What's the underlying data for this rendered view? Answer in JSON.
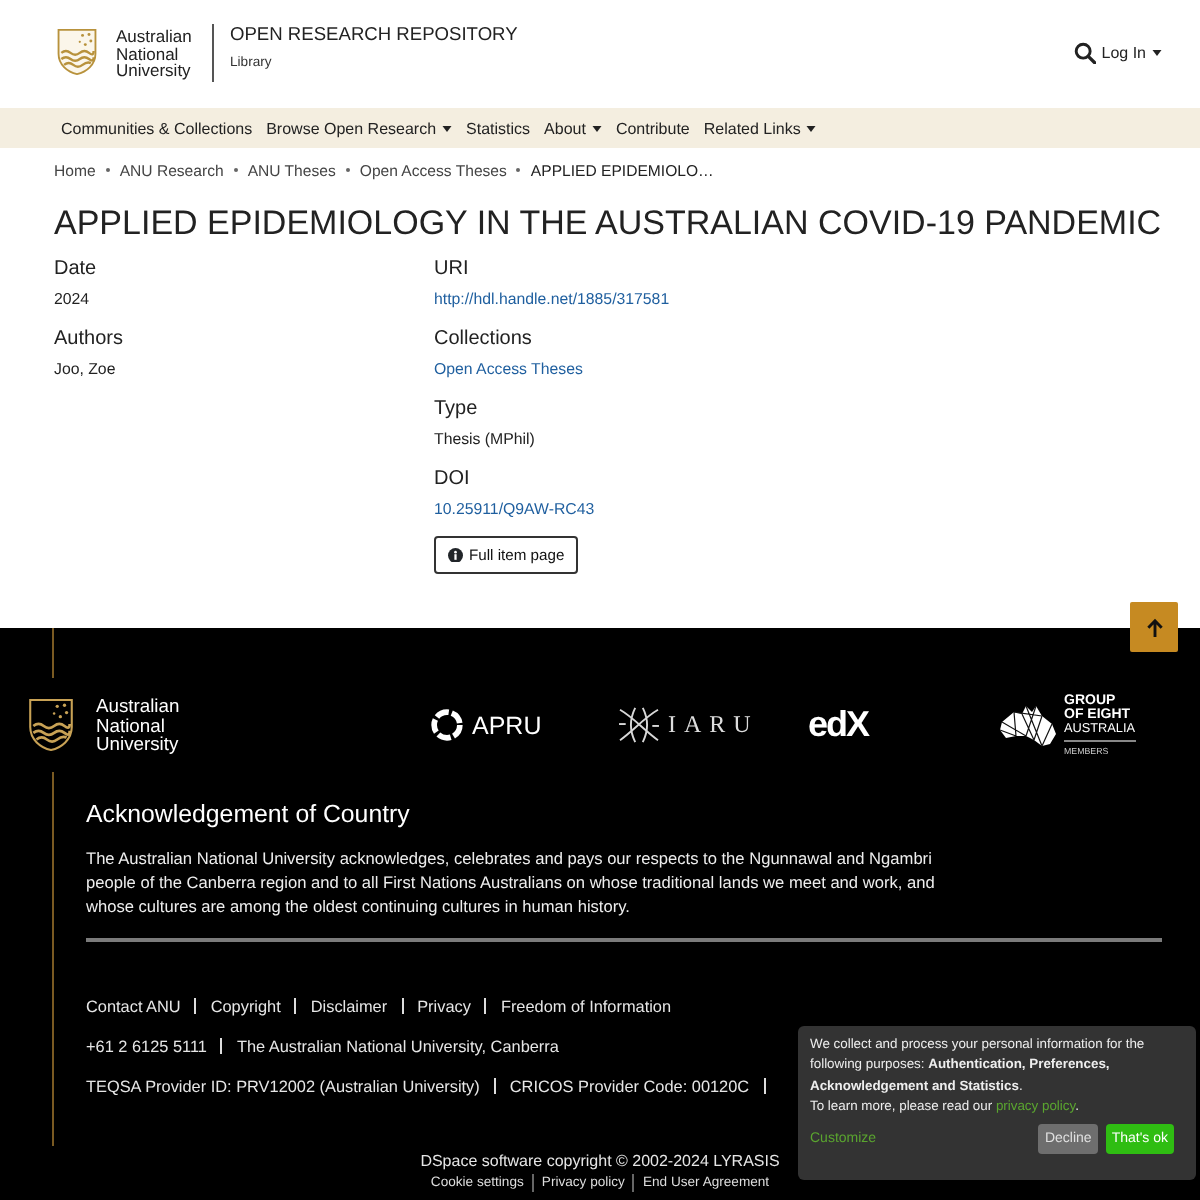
{
  "header": {
    "logo_text": "Australian National University",
    "site_title": "OPEN RESEARCH REPOSITORY",
    "subtitle": "Library",
    "login": "Log In"
  },
  "nav": [
    {
      "label": "Communities & Collections",
      "dropdown": false
    },
    {
      "label": "Browse Open Research",
      "dropdown": true
    },
    {
      "label": "Statistics",
      "dropdown": false
    },
    {
      "label": "About",
      "dropdown": true
    },
    {
      "label": "Contribute",
      "dropdown": false
    },
    {
      "label": "Related Links",
      "dropdown": true
    }
  ],
  "breadcrumb": [
    {
      "label": "Home",
      "current": false
    },
    {
      "label": "ANU Research",
      "current": false
    },
    {
      "label": "ANU Theses",
      "current": false
    },
    {
      "label": "Open Access Theses",
      "current": false
    },
    {
      "label": "APPLIED EPIDEMIOLO…",
      "current": true
    }
  ],
  "item": {
    "title": "APPLIED EPIDEMIOLOGY IN THE AUSTRALIAN COVID-19 PANDEMIC",
    "left_fields": [
      {
        "label": "Date",
        "value": "2024",
        "kind": "text"
      },
      {
        "label": "Authors",
        "value": "Joo, Zoe",
        "kind": "text"
      }
    ],
    "right_fields": [
      {
        "label": "URI",
        "value": "http://hdl.handle.net/1885/317581",
        "kind": "link"
      },
      {
        "label": "Collections",
        "value": "Open Access Theses",
        "kind": "link"
      },
      {
        "label": "Type",
        "value": "Thesis (MPhil)",
        "kind": "text"
      },
      {
        "label": "DOI",
        "value": "10.25911/Q9AW-RC43",
        "kind": "link"
      }
    ],
    "full_item_button": "Full item page"
  },
  "footer": {
    "logo_text": "Australian National University",
    "partners": [
      {
        "name": "APRU",
        "kind": "ring"
      },
      {
        "name": "IARU",
        "kind": "knot"
      },
      {
        "name": "edX",
        "kind": "plain"
      },
      {
        "name": "GROUP OF EIGHT",
        "subname": "AUSTRALIA",
        "caption": "MEMBERS",
        "kind": "map"
      }
    ],
    "acknowledgement": {
      "heading": "Acknowledgement of Country",
      "text": "The Australian National University acknowledges, celebrates and pays our respects to the Ngunnawal and Ngambri people of the Canberra region and to all First Nations Australians on whose traditional lands we meet and work, and whose cultures are among the oldest continuing cultures in human history."
    },
    "link_rows": [
      {
        "items": [
          "Contact ANU",
          "Copyright",
          "Disclaimer",
          "Privacy",
          "Freedom of Information"
        ],
        "continues": false
      },
      {
        "items": [
          "+61 2 6125 5111",
          "The Australian National University, Canberra"
        ],
        "continues": false
      },
      {
        "items": [
          "TEQSA Provider ID: PRV12002 (Australian University)",
          "CRICOS Provider Code: 00120C"
        ],
        "continues": true
      }
    ],
    "copyright": "DSpace software copyright © 2002-2024 LYRASIS",
    "bottom_links": [
      "Cookie settings",
      "Privacy policy",
      "End User Agreement"
    ]
  },
  "cookie_notice": {
    "text": "We collect and process your personal information for the following purposes: **Authentication, Preferences, Acknowledgement and Statistics**.",
    "learn_more": "To learn more, please read our ",
    "policy_link": "privacy policy",
    "after_link": ".",
    "customize": "Customize",
    "decline": "Decline",
    "accept": "That's ok"
  }
}
